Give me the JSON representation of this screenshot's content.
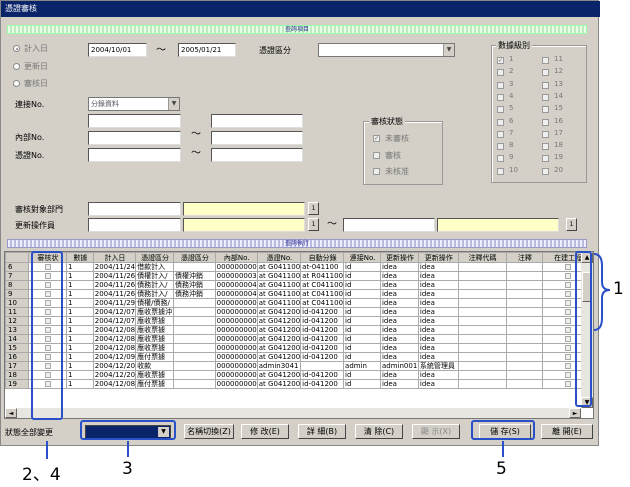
{
  "window": {
    "title": "憑證審核"
  },
  "sections": {
    "query_header": "查詢項目",
    "result_header": "查詢執行"
  },
  "date_filter": {
    "options": [
      "計入日",
      "更新日",
      "審核日"
    ],
    "selected": 0,
    "from": "2004/10/01",
    "tilde": "〜",
    "to": "2005/01/21"
  },
  "voucher_type": {
    "label": "憑證區分",
    "value": ""
  },
  "ledger": {
    "label": "連接No.",
    "value": "分錄資料"
  },
  "internal_no": {
    "label": "內部No.",
    "tilde": "〜"
  },
  "voucher_no": {
    "label": "憑證No.",
    "tilde": "〜"
  },
  "audit_status": {
    "title": "審核狀態",
    "items": [
      {
        "label": "未審核",
        "checked": true
      },
      {
        "label": "審核",
        "checked": false
      },
      {
        "label": "未核准",
        "checked": false
      }
    ]
  },
  "data_level": {
    "title": "數據級別",
    "left": [
      "1",
      "2",
      "3",
      "4",
      "5",
      "6",
      "7",
      "8",
      "9",
      "10"
    ],
    "right": [
      "11",
      "12",
      "13",
      "14",
      "15",
      "16",
      "17",
      "18",
      "19",
      "20"
    ]
  },
  "target_dept": {
    "label": "審核對象部門",
    "btn": "1"
  },
  "updater": {
    "label": "更新操作員",
    "btn": "1",
    "tilde": "〜"
  },
  "table": {
    "columns": [
      "審核状",
      "數據",
      "計入日",
      "憑證區分",
      "憑證區分",
      "內部No.",
      "憑證No.",
      "自動分錄",
      "連接No.",
      "更新操作",
      "更新操作",
      "注釋代碼",
      "注釋",
      "在建工程"
    ],
    "rows": [
      {
        "n": "6",
        "data": "1",
        "date": "2004/11/24",
        "type": "借款計入",
        "sub": "",
        "inner": "000000000",
        "vno": "at G041100",
        "auto": "at-041100",
        "link": "id",
        "upd": "idea",
        "upd2": "idea"
      },
      {
        "n": "7",
        "data": "1",
        "date": "2004/11/26",
        "type": "債權計入/",
        "sub": "債權沖銷",
        "inner": "000000003",
        "vno": "at G041100",
        "auto": "at R041100",
        "link": "id",
        "upd": "idea",
        "upd2": "idea"
      },
      {
        "n": "8",
        "data": "1",
        "date": "2004/11/26",
        "type": "債務計入/",
        "sub": "債務沖銷",
        "inner": "000000004",
        "vno": "at G041100",
        "auto": "at C041100",
        "link": "id",
        "upd": "idea",
        "upd2": "idea"
      },
      {
        "n": "9",
        "data": "1",
        "date": "2004/11/26",
        "type": "債務計入/",
        "sub": "債務沖銷",
        "inner": "000000004",
        "vno": "at G041100",
        "auto": "at C041100",
        "link": "id",
        "upd": "idea",
        "upd2": "idea"
      },
      {
        "n": "10",
        "data": "1",
        "date": "2004/11/29",
        "type": "債權/債務/",
        "sub": "",
        "inner": "000000000",
        "vno": "at G041100",
        "auto": "at C041100",
        "link": "id",
        "upd": "idea",
        "upd2": "idea"
      },
      {
        "n": "11",
        "data": "1",
        "date": "2004/12/07",
        "type": "應收票據沖",
        "sub": "",
        "inner": "000000000",
        "vno": "at G041200",
        "auto": "id-041200",
        "link": "id",
        "upd": "idea",
        "upd2": "idea"
      },
      {
        "n": "12",
        "data": "1",
        "date": "2004/12/07",
        "type": "應收票據",
        "sub": "",
        "inner": "000000000",
        "vno": "at G041200",
        "auto": "id-041200",
        "link": "id",
        "upd": "idea",
        "upd2": "idea"
      },
      {
        "n": "13",
        "data": "1",
        "date": "2004/12/08",
        "type": "應收票據",
        "sub": "",
        "inner": "000000000",
        "vno": "at G041200",
        "auto": "id-041200",
        "link": "id",
        "upd": "idea",
        "upd2": "idea"
      },
      {
        "n": "14",
        "data": "1",
        "date": "2004/12/08",
        "type": "應收票據",
        "sub": "",
        "inner": "000000000",
        "vno": "at G041200",
        "auto": "id-041200",
        "link": "id",
        "upd": "idea",
        "upd2": "idea"
      },
      {
        "n": "15",
        "data": "1",
        "date": "2004/12/08",
        "type": "應收票據",
        "sub": "",
        "inner": "000000000",
        "vno": "at G041200",
        "auto": "id-041200",
        "link": "id",
        "upd": "idea",
        "upd2": "idea"
      },
      {
        "n": "16",
        "data": "1",
        "date": "2004/12/09",
        "type": "應付票據",
        "sub": "",
        "inner": "000000000",
        "vno": "at G041200",
        "auto": "id-041200",
        "link": "id",
        "upd": "idea",
        "upd2": "idea"
      },
      {
        "n": "17",
        "data": "1",
        "date": "2004/12/20",
        "type": "收款",
        "sub": "",
        "inner": "000000000",
        "vno": "admin3041",
        "auto": "",
        "link": "admin",
        "upd": "admin001",
        "upd2": "系統管理員"
      },
      {
        "n": "18",
        "data": "1",
        "date": "2004/12/20",
        "type": "應收票據",
        "sub": "",
        "inner": "000000000",
        "vno": "at G041200",
        "auto": "id-041200",
        "link": "id",
        "upd": "idea",
        "upd2": "idea"
      },
      {
        "n": "19",
        "data": "1",
        "date": "2004/12/08",
        "type": "應付票據",
        "sub": "",
        "inner": "000000000",
        "vno": "at G041200",
        "auto": "id-041200",
        "link": "id",
        "upd": "idea",
        "upd2": "idea"
      }
    ]
  },
  "bottom": {
    "status_label": "狀態全部變更",
    "buttons": [
      "名稱切換(Z)",
      "修 改(E)",
      "詳 細(B)",
      "清 除(C)",
      "顯 示(X)",
      "儲 存(S)",
      "離 開(E)"
    ]
  },
  "annotations": {
    "n1": "1",
    "n24": "2、4",
    "n3": "3",
    "n5": "5"
  }
}
